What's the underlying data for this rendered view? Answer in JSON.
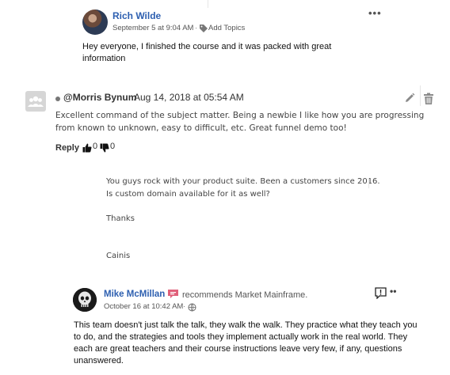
{
  "post1": {
    "author": "Rich Wilde",
    "date": "September 5 at 9:04 AM",
    "separator": "·",
    "tag_label": "Add Topics",
    "more_label": "•••",
    "body": "Hey everyone, I finished the course and it was packed with great information"
  },
  "comment2": {
    "author": "@Morris Bynum",
    "date": "Aug 14, 2018 at 05:54 AM",
    "body": "Excellent command of the subject matter. Being a newbie I like how you are progressing from known to unknown, easy to difficult, etc. Great funnel demo too!",
    "reply_label": "Reply",
    "likes": "0",
    "dislikes": "0"
  },
  "comment3": {
    "line1": "You guys rock with your product suite. Been a customers since 2016.",
    "line2": "Is custom domain available for it as well?",
    "line3": "Thanks",
    "line4": "Cainis"
  },
  "post4": {
    "author": "Mike McMillan",
    "recommend_text": "recommends Market Mainframe.",
    "date": "October 16 at 10:42 AM",
    "separator": "·",
    "more_label": "••",
    "body": "This team doesn't just talk the talk, they walk the walk. They practice what they teach you to do, and the strategies and tools they implement actually work in the real world. They each are great teachers and their course instructions leave very few, if any, questions unanswered."
  },
  "colors": {
    "author_link": "#2d5fb0",
    "badge": "#e0607a"
  },
  "icons": [
    "tag-icon",
    "edit-icon",
    "trash-icon",
    "thumbs-up-icon",
    "thumbs-down-icon",
    "chat-badge-icon",
    "globe-icon",
    "flag-icon"
  ]
}
